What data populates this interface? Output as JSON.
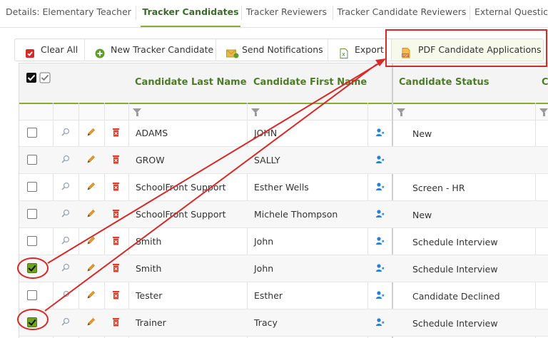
{
  "tabs": [
    {
      "label": "Details: Elementary Teacher ...",
      "active": false
    },
    {
      "label": "Tracker Candidates",
      "active": true
    },
    {
      "label": "Tracker Reviewers",
      "active": false
    },
    {
      "label": "Tracker Candidate Reviewers",
      "active": false
    },
    {
      "label": "External Questic",
      "active": false
    }
  ],
  "toolbar": {
    "clear_all": "Clear All",
    "new_candidate": "New Tracker Candidate",
    "send_notifications": "Send Notifications",
    "export": "Export",
    "pdf_applications": "PDF Candidate Applications"
  },
  "grid": {
    "columns": {
      "last_name": "Candidate Last Name",
      "first_name": "Candidate First Name",
      "status": "Candidate Status",
      "next": "C"
    },
    "rows": [
      {
        "last": "ADAMS",
        "first": "JOHN",
        "status": "New",
        "checked": false
      },
      {
        "last": "GROW",
        "first": "SALLY",
        "status": "",
        "checked": false
      },
      {
        "last": "SchoolFront Support",
        "first": "Esther Wells",
        "status": "Screen - HR",
        "checked": false
      },
      {
        "last": "SchoolFront Support",
        "first": "Michele Thompson",
        "status": "New",
        "checked": false
      },
      {
        "last": "Smith",
        "first": "John",
        "status": "Schedule Interview",
        "checked": false
      },
      {
        "last": "Smith",
        "first": "John",
        "status": "Schedule Interview",
        "checked": true
      },
      {
        "last": "Tester",
        "first": "Esther",
        "status": "Candidate Declined",
        "checked": false
      },
      {
        "last": "Trainer",
        "first": "Tracy",
        "status": "Schedule Interview",
        "checked": true
      }
    ]
  },
  "colors": {
    "accent": "#8aac2a",
    "header_text": "#4e7a2a",
    "annotation": "#d42a2a"
  }
}
